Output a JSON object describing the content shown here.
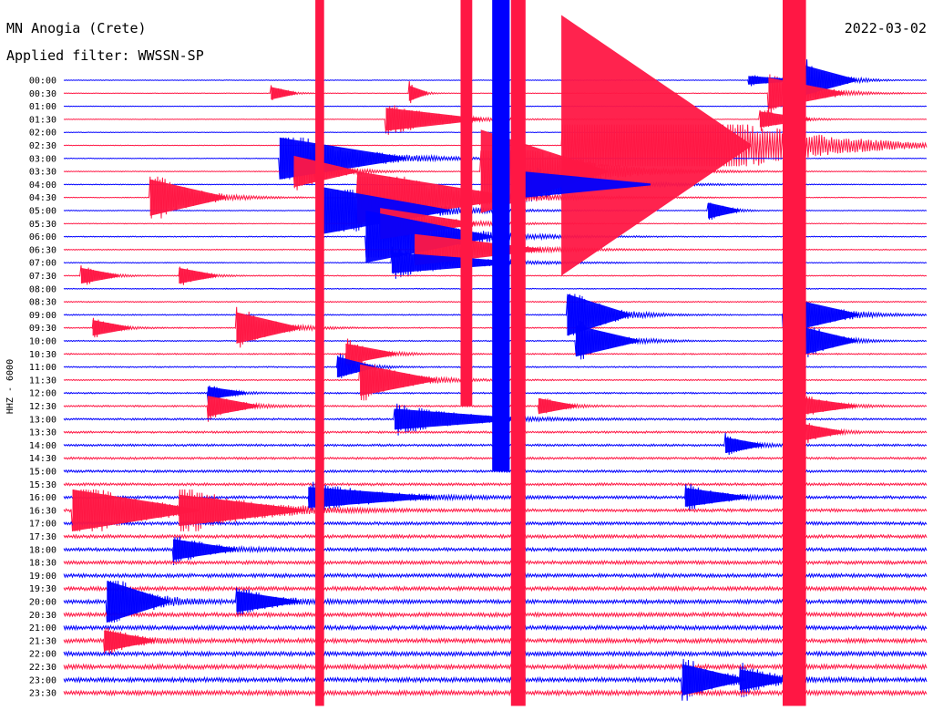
{
  "header": {
    "station": "MN Anogia (Crete)",
    "filter": "Applied filter: WWSSN-SP",
    "date": "2022-03-02"
  },
  "channel_label": "HHZ - 6000",
  "colors": {
    "trace_a": "#0000ff",
    "trace_b": "#ff1744",
    "background": "#ffffff",
    "text": "#000000"
  },
  "chart_data": {
    "type": "line",
    "title": "",
    "ylabel": "HHZ - 6000",
    "row_labels": [
      "00:00",
      "00:30",
      "01:00",
      "01:30",
      "02:00",
      "02:30",
      "03:00",
      "03:30",
      "04:00",
      "04:30",
      "05:00",
      "05:30",
      "06:00",
      "06:30",
      "07:00",
      "07:30",
      "08:00",
      "08:30",
      "09:00",
      "09:30",
      "10:00",
      "10:30",
      "11:00",
      "11:30",
      "12:00",
      "12:30",
      "13:00",
      "13:30",
      "14:00",
      "14:30",
      "15:00",
      "15:30",
      "16:00",
      "16:30",
      "17:00",
      "17:30",
      "18:00",
      "18:30",
      "19:00",
      "19:30",
      "20:00",
      "20:30",
      "21:00",
      "21:30",
      "22:00",
      "22:30",
      "23:00",
      "23:30"
    ],
    "row_minutes": 30,
    "row_colors": [
      "#0000ff",
      "#ff1744"
    ],
    "noise_level_by_row": [
      0.03,
      0.03,
      0.03,
      0.03,
      0.03,
      0.03,
      0.04,
      0.04,
      0.04,
      0.04,
      0.04,
      0.04,
      0.05,
      0.05,
      0.05,
      0.05,
      0.05,
      0.06,
      0.06,
      0.06,
      0.06,
      0.07,
      0.07,
      0.07,
      0.08,
      0.09,
      0.1,
      0.11,
      0.12,
      0.12,
      0.13,
      0.14,
      0.15,
      0.16,
      0.17,
      0.18,
      0.18,
      0.19,
      0.2,
      0.21,
      0.21,
      0.22,
      0.22,
      0.23,
      0.23,
      0.24,
      0.24,
      0.25
    ],
    "events": [
      {
        "row": 0,
        "minute": 23.8,
        "amp": 0.8,
        "dur": 0.8
      },
      {
        "row": 0,
        "minute": 25.8,
        "amp": 2.8,
        "dur": 0.8
      },
      {
        "row": 1,
        "minute": 7.2,
        "amp": 1.2,
        "dur": 0.4
      },
      {
        "row": 1,
        "minute": 12.0,
        "amp": 1.5,
        "dur": 0.3
      },
      {
        "row": 1,
        "minute": 24.5,
        "amp": 3.0,
        "dur": 1.2
      },
      {
        "row": 3,
        "minute": 11.2,
        "amp": 2.2,
        "dur": 1.5
      },
      {
        "row": 3,
        "minute": 24.2,
        "amp": 1.5,
        "dur": 0.8
      },
      {
        "row": 5,
        "minute": 17.3,
        "amp": 25.0,
        "dur": 3.0
      },
      {
        "row": 6,
        "minute": 7.5,
        "amp": 4.0,
        "dur": 2.0
      },
      {
        "row": 7,
        "minute": 14.5,
        "amp": 8.0,
        "dur": 2.0
      },
      {
        "row": 7,
        "minute": 8.0,
        "amp": 3.0,
        "dur": 1.0
      },
      {
        "row": 8,
        "minute": 16.0,
        "amp": 2.5,
        "dur": 2.0
      },
      {
        "row": 9,
        "minute": 3.0,
        "amp": 3.5,
        "dur": 1.2
      },
      {
        "row": 9,
        "minute": 10.2,
        "amp": 5.0,
        "dur": 2.5
      },
      {
        "row": 10,
        "minute": 9.0,
        "amp": 4.5,
        "dur": 2.0
      },
      {
        "row": 10,
        "minute": 22.4,
        "amp": 1.5,
        "dur": 0.5
      },
      {
        "row": 11,
        "minute": 11.0,
        "amp": 3.0,
        "dur": 1.5
      },
      {
        "row": 12,
        "minute": 10.5,
        "amp": 5.0,
        "dur": 2.0
      },
      {
        "row": 13,
        "minute": 12.2,
        "amp": 3.0,
        "dur": 2.0
      },
      {
        "row": 14,
        "minute": 11.4,
        "amp": 2.0,
        "dur": 2.0
      },
      {
        "row": 15,
        "minute": 0.6,
        "amp": 1.5,
        "dur": 0.6
      },
      {
        "row": 15,
        "minute": 4.0,
        "amp": 1.5,
        "dur": 0.6
      },
      {
        "row": 18,
        "minute": 17.5,
        "amp": 4.0,
        "dur": 1.0
      },
      {
        "row": 18,
        "minute": 25.0,
        "amp": 3.5,
        "dur": 1.2
      },
      {
        "row": 19,
        "minute": 6.0,
        "amp": 3.0,
        "dur": 1.0
      },
      {
        "row": 19,
        "minute": 1.0,
        "amp": 1.5,
        "dur": 0.6
      },
      {
        "row": 20,
        "minute": 17.8,
        "amp": 3.0,
        "dur": 1.0
      },
      {
        "row": 20,
        "minute": 25.8,
        "amp": 2.5,
        "dur": 0.8
      },
      {
        "row": 21,
        "minute": 9.8,
        "amp": 2.0,
        "dur": 0.8
      },
      {
        "row": 22,
        "minute": 9.5,
        "amp": 2.0,
        "dur": 0.6
      },
      {
        "row": 23,
        "minute": 10.3,
        "amp": 3.0,
        "dur": 1.2
      },
      {
        "row": 24,
        "minute": 5.0,
        "amp": 1.2,
        "dur": 0.6
      },
      {
        "row": 25,
        "minute": 5.0,
        "amp": 2.0,
        "dur": 0.8
      },
      {
        "row": 25,
        "minute": 16.5,
        "amp": 1.5,
        "dur": 0.6
      },
      {
        "row": 25,
        "minute": 25.8,
        "amp": 1.5,
        "dur": 0.8
      },
      {
        "row": 26,
        "minute": 11.5,
        "amp": 2.0,
        "dur": 2.0
      },
      {
        "row": 27,
        "minute": 25.8,
        "amp": 1.5,
        "dur": 0.6
      },
      {
        "row": 28,
        "minute": 23.0,
        "amp": 1.5,
        "dur": 0.6
      },
      {
        "row": 32,
        "minute": 8.5,
        "amp": 2.0,
        "dur": 2.0
      },
      {
        "row": 32,
        "minute": 21.6,
        "amp": 1.8,
        "dur": 1.0
      },
      {
        "row": 33,
        "minute": 0.3,
        "amp": 4.0,
        "dur": 2.0
      },
      {
        "row": 33,
        "minute": 4.0,
        "amp": 3.0,
        "dur": 2.0
      },
      {
        "row": 36,
        "minute": 3.8,
        "amp": 2.0,
        "dur": 1.0
      },
      {
        "row": 40,
        "minute": 1.5,
        "amp": 4.0,
        "dur": 1.0
      },
      {
        "row": 40,
        "minute": 6.0,
        "amp": 2.0,
        "dur": 1.0
      },
      {
        "row": 43,
        "minute": 1.4,
        "amp": 2.0,
        "dur": 0.8
      },
      {
        "row": 46,
        "minute": 21.5,
        "amp": 3.0,
        "dur": 1.0
      },
      {
        "row": 46,
        "minute": 23.5,
        "amp": 2.0,
        "dur": 0.8
      }
    ],
    "long_events": [
      {
        "row_start": 0,
        "row_end": 47,
        "minute": 8.9,
        "amp": 3.0,
        "color": "#ff1744"
      },
      {
        "row_start": 0,
        "row_end": 24,
        "minute": 14.0,
        "amp": 4.0,
        "color": "#ff1744"
      },
      {
        "row_start": 0,
        "row_end": 47,
        "minute": 15.8,
        "amp": 5.0,
        "color": "#ff1744"
      },
      {
        "row_start": 0,
        "row_end": 29,
        "minute": 15.2,
        "amp": 6.0,
        "color": "#0000ff"
      },
      {
        "row_start": 0,
        "row_end": 47,
        "minute": 25.4,
        "amp": 8.0,
        "color": "#ff1744"
      }
    ]
  }
}
